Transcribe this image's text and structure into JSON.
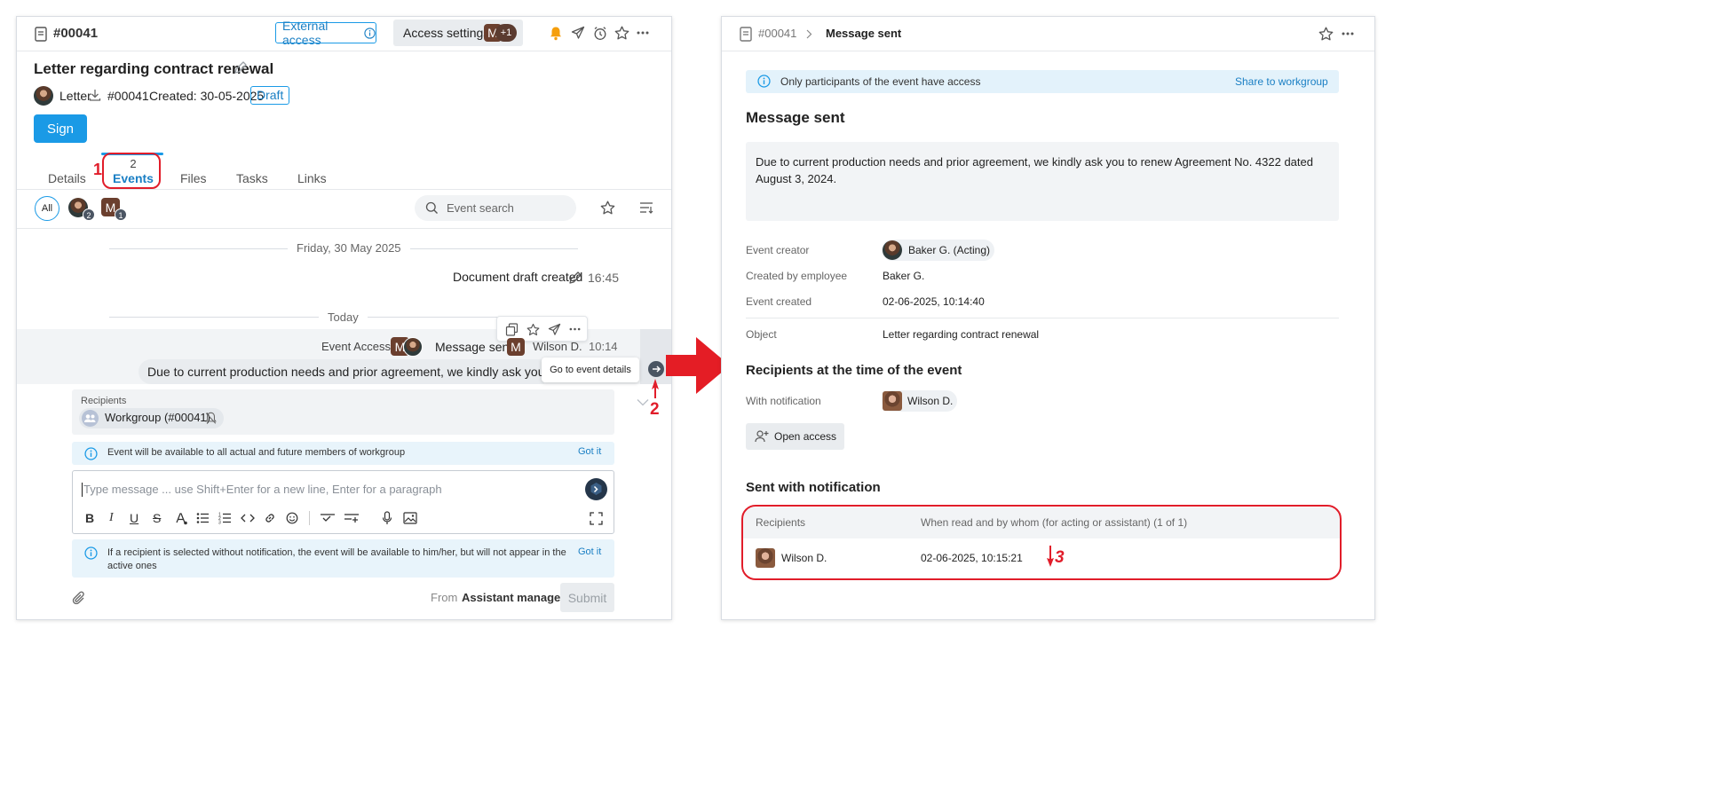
{
  "left": {
    "doc_number": "#00041",
    "external_access": "External access",
    "access_settings": "Access settings",
    "access_m": "M",
    "access_plus": "+1",
    "title": "Letter regarding contract renewal",
    "doc_type": "Letter",
    "doc_num2": "#00041",
    "created": "Created: 30-05-2025",
    "status": "Draft",
    "sign": "Sign",
    "tabs": {
      "details": "Details",
      "events_count": "2",
      "events": "Events",
      "files": "Files",
      "tasks": "Tasks",
      "links": "Links"
    },
    "filter_all": "All",
    "filter_badge1": "2",
    "filter_m": "M",
    "filter_badge2": "1",
    "search_placeholder": "Event search",
    "date1": "Friday, 30 May 2025",
    "draft_created": "Document draft created",
    "time1": "16:45",
    "date2": "Today",
    "event_access": "Event Access",
    "event_m": "M",
    "message_sent": "Message sent",
    "sender_m": "M",
    "sender": "Wilson D.",
    "time2": "10:14",
    "message_preview": "Due to current production needs and prior agreement, we kindly ask you to renew",
    "tooltip": "Go to event details",
    "recipients_label": "Recipients",
    "workgroup": "Workgroup (#00041)",
    "info1": "Event will be available to all actual and future members of workgroup",
    "got_it1": "Got it",
    "editor_placeholder": "Type message ... use Shift+Enter for a new line, Enter for a paragraph",
    "info2": "If a recipient is selected without notification, the event will be available to him/her, but will not appear in the active ones",
    "got_it2": "Got it",
    "from_label": "From",
    "from_value": "Assistant manager",
    "submit": "Submit"
  },
  "right": {
    "breadcrumb_num": "#00041",
    "breadcrumb_current": "Message sent",
    "banner_text": "Only participants of the event have access",
    "banner_link": "Share to workgroup",
    "heading": "Message sent",
    "message_body": "Due to current production needs and prior agreement, we kindly ask you to renew Agreement No. 4322 dated August 3, 2024.",
    "fields": {
      "creator_label": "Event creator",
      "creator_value": "Baker G. (Acting)",
      "employee_label": "Created by employee",
      "employee_value": "Baker G.",
      "created_label": "Event created",
      "created_value": "02-06-2025, 10:14:40",
      "object_label": "Object",
      "object_value": "Letter regarding contract renewal"
    },
    "recipients_heading": "Recipients at the time of the event",
    "with_notification_label": "With notification",
    "with_notification_value": "Wilson D.",
    "open_access": "Open access",
    "sent_heading": "Sent with notification",
    "table": {
      "col1": "Recipients",
      "col2": "When read and by whom (for acting or assistant) (1 of 1)",
      "row_name": "Wilson D.",
      "row_time": "02-06-2025, 10:15:21"
    }
  },
  "annotations": {
    "n1": "1",
    "n2": "2",
    "n3": "3"
  },
  "colors": {
    "accent": "#1a9ae6",
    "annotation": "#e11d2a",
    "bell": "#f59e0b"
  }
}
